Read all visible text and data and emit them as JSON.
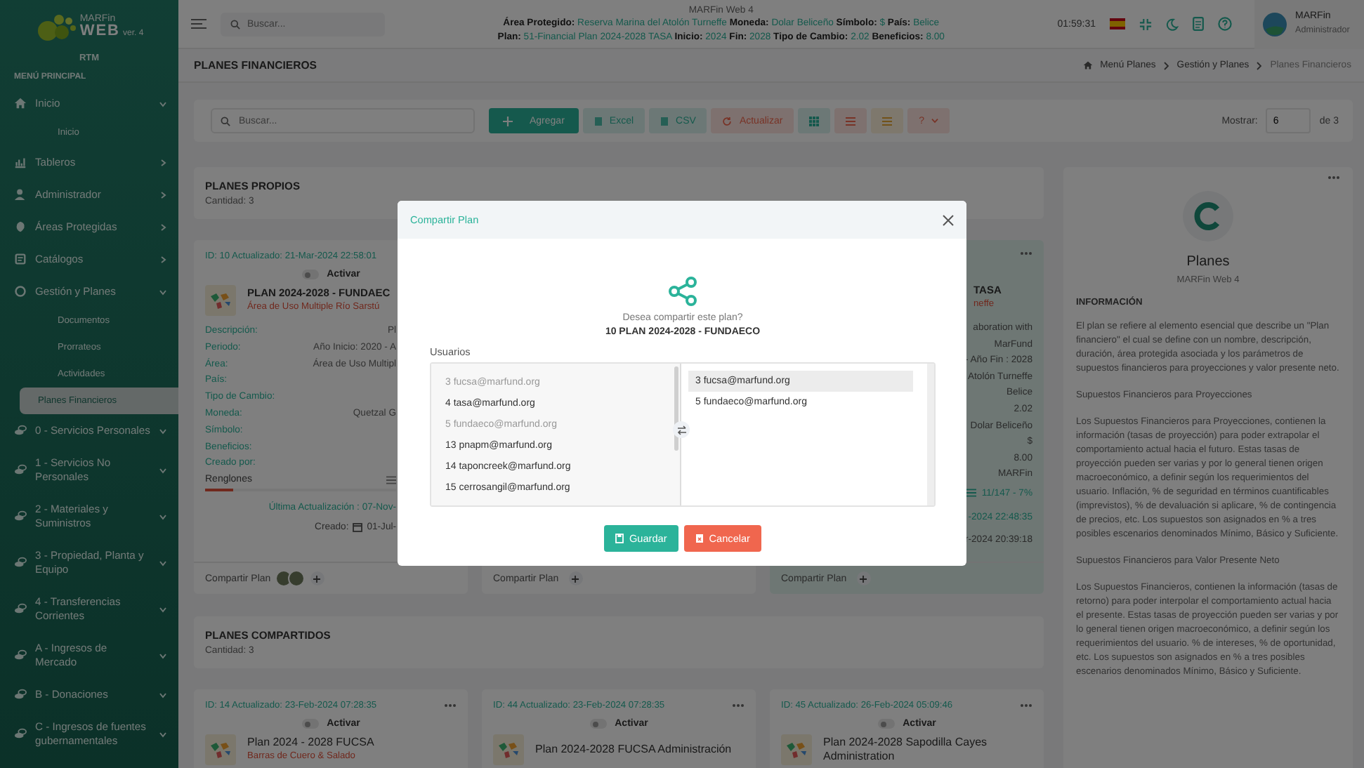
{
  "sidebar": {
    "logo": {
      "brand": "MARFin",
      "product": "WEB",
      "version": "ver. 4"
    },
    "org": "RTM",
    "section_title": "MENÚ PRINCIPAL",
    "items": [
      {
        "label": "Inicio",
        "expanded": true,
        "children": [
          {
            "label": "Inicio",
            "selected": false
          }
        ]
      },
      {
        "label": "Tableros",
        "expanded": false
      },
      {
        "label": "Administrador",
        "expanded": false
      },
      {
        "label": "Áreas Protegidas",
        "expanded": false
      },
      {
        "label": "Catálogos",
        "expanded": false
      },
      {
        "label": "Gestión y Planes",
        "expanded": true,
        "children": [
          {
            "label": "Documentos",
            "selected": false
          },
          {
            "label": "Prorrateos",
            "selected": false
          },
          {
            "label": "Actividades",
            "selected": false
          },
          {
            "label": "Planes Financieros",
            "selected": true
          }
        ]
      },
      {
        "label": "0 - Servicios Personales",
        "expanded": true
      },
      {
        "label": "1 - Servicios No Personales",
        "expanded": true
      },
      {
        "label": "2 - Materiales y Suministros",
        "expanded": true
      },
      {
        "label": "3 - Propiedad, Planta y Equipo",
        "expanded": true
      },
      {
        "label": "4 - Transferencias Corrientes",
        "expanded": true
      },
      {
        "label": "A - Ingresos de Mercado",
        "expanded": true
      },
      {
        "label": "B - Donaciones",
        "expanded": true
      },
      {
        "label": "C - Ingresos de fuentes gubernamentales",
        "expanded": true
      }
    ]
  },
  "header": {
    "search": {
      "placeholder": "Buscar..."
    },
    "app_title": "MARFin Web 4",
    "info_lines": [
      [
        {
          "label": "Área Protegido:",
          "value": "Reserva Marina del Atolón Turneffe"
        },
        {
          "label": "Moneda:",
          "value": "Dolar Beliceño"
        },
        {
          "label": "Símbolo:",
          "value": "$"
        },
        {
          "label": "País:",
          "value": "Belice"
        }
      ],
      [
        {
          "label": "Plan:",
          "value": "51-Financial Plan 2024-2028 TASA"
        },
        {
          "label": "Inicio:",
          "value": "2024"
        },
        {
          "label": "Fin:",
          "value": "2028"
        },
        {
          "label": "Tipo de Cambio:",
          "value": "2.02"
        },
        {
          "label": "Beneficios:",
          "value": "8.00"
        }
      ]
    ],
    "time": "01:59:31",
    "user": {
      "name": "MARFin",
      "role": "Administrador"
    }
  },
  "page_header": {
    "title": "PLANES FINANCIEROS",
    "breadcrumbs": [
      {
        "label": "Menú Planes",
        "selected": false
      },
      {
        "label": "Gestión y Planes",
        "selected": false
      },
      {
        "label": "Planes Financieros",
        "selected": true
      }
    ]
  },
  "toolbar": {
    "search": {
      "placeholder": "Buscar..."
    },
    "buttons": [
      {
        "kind": "label",
        "label": "Agregar"
      },
      {
        "kind": "label",
        "label": "Excel"
      },
      {
        "kind": "label",
        "label": "CSV"
      },
      {
        "kind": "label",
        "label": "Actualizar"
      },
      {
        "kind": "icon"
      },
      {
        "kind": "icon"
      },
      {
        "kind": "icon"
      },
      {
        "kind": "menu",
        "label": "?"
      }
    ],
    "show_label": "Mostrar:",
    "page_size": "6",
    "page_total": "de 3"
  },
  "own_plans": {
    "title": "PLANES PROPIOS",
    "count": "Cantidad: 3",
    "cards": [
      {
        "highlighted": false,
        "id_line": "ID: 10 Actualizado: 21-Mar-2024 22:58:01",
        "active": false,
        "active_label": "Activar",
        "title": "PLAN 2024-2028 - FUNDAEC",
        "subtitle": "Área de Uso Multiple Río Sarstú",
        "fields": [
          {
            "label": "Descripción:",
            "value": "Pl"
          },
          {
            "label": "Periodo:",
            "value": "Año Inicio: 2020 - A"
          },
          {
            "label": "Área:",
            "value": "Área de Uso Multipl"
          },
          {
            "label": "País:"
          },
          {
            "label": "Tipo de Cambio:"
          },
          {
            "label": "Moneda:",
            "value": "Quetzal G"
          },
          {
            "label": "Símbolo:"
          },
          {
            "label": "Beneficios:"
          },
          {
            "label": "Creado por:"
          }
        ],
        "lines_label": "Renglones",
        "level": 0.15,
        "last_update": "Última Actualización : 07-Nov-",
        "created_label": "Creado:",
        "created_date": "01-Jul-",
        "share_label": "Compartir Plan",
        "shared_avatars": [
          {
            "kind": "photo"
          },
          {
            "kind": "photo"
          }
        ]
      },
      {
        "highlighted": false,
        "share_label": "Compartir Plan"
      },
      {
        "highlighted": true,
        "title": "TASA",
        "subtitle": "neffe",
        "values": [
          "aboration with",
          "MarFund",
          "- Año Fin : 2028",
          "Atolón Turneffe",
          "Belice",
          "2.02",
          "Dolar Beliceño",
          "$",
          "8.00",
          "MARFin"
        ],
        "progress": "11/147 - 7%",
        "dates": [
          "-2024 22:48:35",
          "r-2024 20:39:18"
        ],
        "share_label": "Compartir Plan"
      }
    ]
  },
  "shared_plans": {
    "title": "PLANES COMPARTIDOS",
    "count": "Cantidad: 3",
    "cards": [
      {
        "id_line": "ID: 14 Actualizado: 23-Feb-2024 07:28:35",
        "active": false,
        "active_label": "Activar",
        "title": "Plan 2024 - 2028 FUCSA",
        "subtitle": "Barras de Cuero & Salado"
      },
      {
        "id_line": "ID: 44 Actualizado: 23-Feb-2024 07:28:35",
        "active": false,
        "active_label": "Activar",
        "title": "Plan 2024-2028 FUCSA Administración"
      },
      {
        "id_line": "ID: 45 Actualizado: 26-Feb-2024 05:09:46",
        "active": false,
        "active_label": "Activar",
        "title": "Plan 2024-2028 Sapodilla Cayes Administration"
      }
    ]
  },
  "info_panel": {
    "title": "Planes",
    "subtitle": "MARFin Web 4",
    "heading": "INFORMACIÓN",
    "paragraphs": [
      "El plan se refiere al elemento esencial que describe un \"Plan financiero\" el cual se define con un nombre, descripción, duración, área protegida asociada y los parámetros de supuestos financieros para proyecciones y valor presente neto.",
      "Supuestos Financieros para Proyecciones",
      "Los Supuestos Financieros para Proyecciones, contienen la información (tasas de proyección) para poder extrapolar el comportamiento actual hacia el futuro. Estas tasas de proyección pueden ser varias y por lo general tienen origen macroeconómico, a definir según los requerimientos del usuario. Inflación, % de seguridad en términos cuantificables (imprevistos), % de devaluación si aplicare, % de contingencia de precios, etc. Los supuestos son asignados en % a tres posibles escenarios denominados Mínimo, Básico y Suficiente.",
      "Supuestos Financieros para Valor Presente Neto",
      "Los Supuestos Financieros, contienen la información (tasas de retorno) para poder interpolar el comportamiento actual hacia el presente. Estas tasas de proyección pueden ser varias y por lo general tienen origen macroeconómico, a definir según los requerimientos del usuario. % de intereses, % de oportunidad, etc. Los supuestos son asignados en % a tres posibles escenarios denominados Mínimo, Básico y Suficiente."
    ]
  },
  "modal": {
    "title": "Compartir Plan",
    "question": "Desea compartir este plan?",
    "plan": "10 PLAN 2024-2028 - FUNDAECO",
    "users_label": "Usuarios",
    "available": [
      {
        "label": "3 fucsa@marfund.org",
        "disabled": true
      },
      {
        "label": "4 tasa@marfund.org",
        "disabled": false
      },
      {
        "label": "5 fundaeco@marfund.org",
        "disabled": true
      },
      {
        "label": "13 pnapm@marfund.org",
        "disabled": false
      },
      {
        "label": "14 taponcreek@marfund.org",
        "disabled": false
      },
      {
        "label": "15 cerrosangil@marfund.org",
        "disabled": false
      }
    ],
    "chosen": [
      {
        "label": "3 fucsa@marfund.org",
        "selected": true
      },
      {
        "label": "5 fundaeco@marfund.org",
        "selected": false
      }
    ],
    "buttons": [
      {
        "kind": "save",
        "label": "Guardar"
      },
      {
        "kind": "cancel",
        "label": "Cancelar"
      }
    ]
  }
}
